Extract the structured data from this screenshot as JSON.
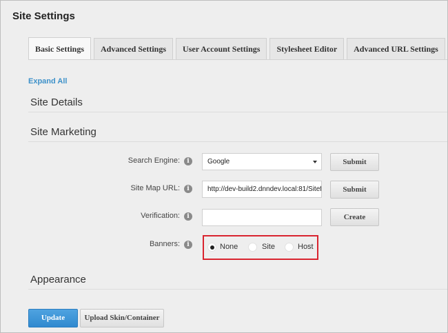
{
  "page": {
    "title": "Site Settings"
  },
  "tabs": [
    {
      "label": "Basic Settings",
      "active": true
    },
    {
      "label": "Advanced Settings"
    },
    {
      "label": "User Account Settings"
    },
    {
      "label": "Stylesheet Editor"
    },
    {
      "label": "Advanced URL Settings"
    }
  ],
  "expand_all": "Expand All",
  "sections": {
    "site_details": "Site Details",
    "site_marketing": "Site Marketing",
    "appearance": "Appearance"
  },
  "marketing": {
    "search_engine": {
      "label": "Search Engine:",
      "value": "Google",
      "button": "Submit"
    },
    "site_map_url": {
      "label": "Site Map URL:",
      "value": "http://dev-build2.dnndev.local:81/Sitef",
      "button": "Submit"
    },
    "verification": {
      "label": "Verification:",
      "value": "",
      "button": "Create"
    },
    "banners": {
      "label": "Banners:",
      "options": [
        "None",
        "Site",
        "Host"
      ],
      "selected": "None",
      "highlight_color": "#d9232e"
    }
  },
  "info_icon_glyph": "i",
  "footer": {
    "update": "Update",
    "upload": "Upload Skin/Container"
  },
  "colors": {
    "accent": "#3d91c9",
    "primary_button": "#3089cf"
  }
}
